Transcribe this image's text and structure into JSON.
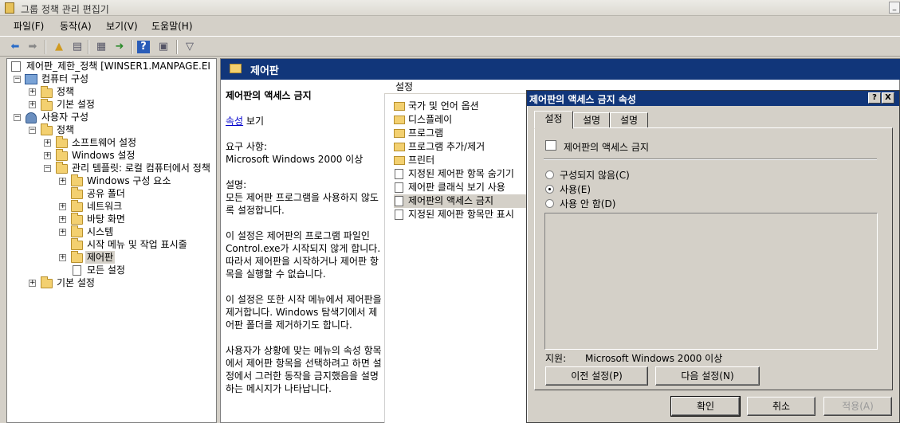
{
  "window": {
    "title": "그룹 정책 관리 편집기"
  },
  "menu": [
    "파일(F)",
    "동작(A)",
    "보기(V)",
    "도움말(H)"
  ],
  "tree": {
    "root": "제어판_제한_정책 [WINSER1.MANPAGE.EI",
    "items": [
      "컴퓨터 구성",
      "정책",
      "기본 설정",
      "사용자 구성",
      "정책",
      "소프트웨어 설정",
      "Windows 설정",
      "관리 템플릿: 로컬 컴퓨터에서 정책",
      "Windows 구성 요소",
      "공유 폴더",
      "네트워크",
      "바탕 화면",
      "시스템",
      "시작 메뉴 및 작업 표시줄",
      "제어판",
      "모든 설정",
      "기본 설정"
    ]
  },
  "header": {
    "title": "제어판"
  },
  "description": {
    "heading": "제어판의 액세스 금지",
    "link": "속성",
    "link_suffix": " 보기",
    "req_label": "요구 사항:",
    "req_value": "Microsoft Windows 2000 이상",
    "desc_label": "설명:",
    "paragraphs": [
      "모든 제어판 프로그램을 사용하지 않도록 설정합니다.",
      "이 설정은 제어판의 프로그램 파일인 Control.exe가 시작되지 않게 합니다. 따라서 제어판을 시작하거나 제어판 항목을 실행할 수 없습니다.",
      "이 설정은 또한 시작 메뉴에서 제어판을 제거합니다. Windows 탐색기에서 제어판 폴더를 제거하기도 합니다.",
      "사용자가 상황에 맞는 메뉴의 속성 항목에서 제어판 항목을 선택하려고 하면 설정에서 그러한 동작을 금지했음을 설명하는 메시지가 나타납니다."
    ]
  },
  "settings": {
    "header": "설정",
    "items": [
      {
        "label": "국가 및 언어 옵션",
        "kind": "folder"
      },
      {
        "label": "디스플레이",
        "kind": "folder"
      },
      {
        "label": "프로그램",
        "kind": "folder"
      },
      {
        "label": "프로그램 추가/제거",
        "kind": "folder"
      },
      {
        "label": "프린터",
        "kind": "folder"
      },
      {
        "label": "지정된 제어판 항목 숨기기",
        "kind": "policy"
      },
      {
        "label": "제어판 클래식 보기 사용",
        "kind": "policy"
      },
      {
        "label": "제어판의 액세스 금지",
        "kind": "policy",
        "selected": true
      },
      {
        "label": "지정된 제어판 항목만 표시",
        "kind": "policy"
      }
    ]
  },
  "dialog": {
    "title": "제어판의 액세스 금지 속성",
    "help": "?",
    "close": "X",
    "tabs": [
      "설정",
      "설명",
      "설명"
    ],
    "policy_name": "제어판의 액세스 금지",
    "options": [
      "구성되지 않음(C)",
      "사용(E)",
      "사용 안 함(D)"
    ],
    "selected_option": 1,
    "support_label": "지원:",
    "support_value": "Microsoft Windows 2000 이상",
    "prev": "이전 설정(P)",
    "next": "다음 설정(N)",
    "ok": "확인",
    "cancel": "취소",
    "apply": "적용(A)"
  }
}
